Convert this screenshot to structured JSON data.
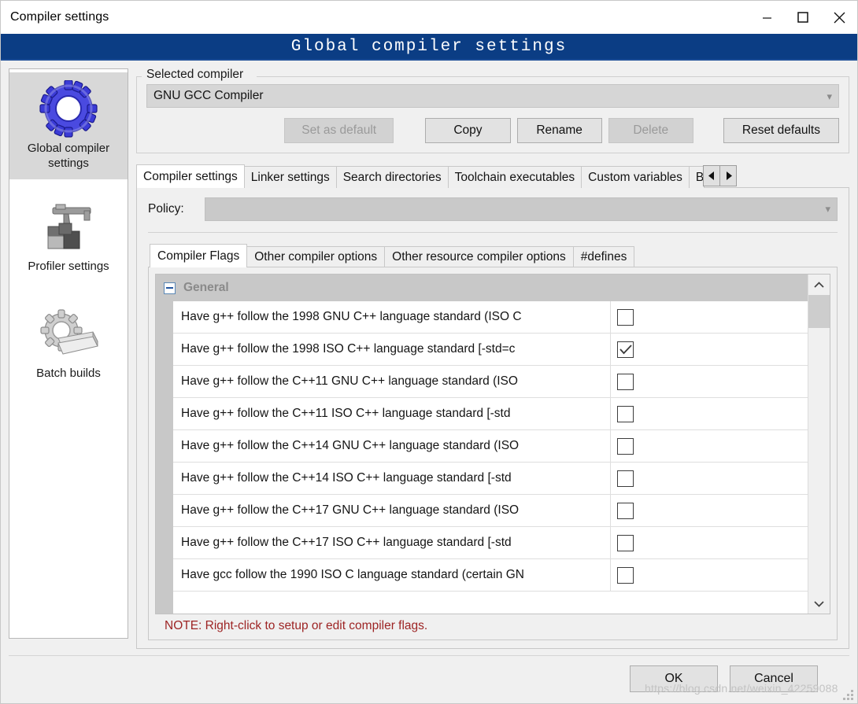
{
  "window": {
    "title": "Compiler settings",
    "minimize_icon": "minimize-icon",
    "maximize_icon": "maximize-icon",
    "close_icon": "close-icon",
    "banner_title": "Global compiler settings",
    "banner_color": "#0b3d84"
  },
  "sidebar": {
    "items": [
      {
        "label": "Global compiler settings",
        "icon": "blue-gear-icon",
        "selected": true
      },
      {
        "label": "Profiler settings",
        "icon": "caliper-icon",
        "selected": false
      },
      {
        "label": "Batch builds",
        "icon": "gear-stack-icon",
        "selected": false
      }
    ]
  },
  "selected_compiler": {
    "legend": "Selected compiler",
    "value": "GNU GCC Compiler",
    "caret_icon": "chevron-down-icon",
    "buttons": [
      {
        "label": "Set as default",
        "disabled": true
      },
      {
        "label": "Copy",
        "disabled": false
      },
      {
        "label": "Rename",
        "disabled": false
      },
      {
        "label": "Delete",
        "disabled": true
      },
      {
        "label": "Reset defaults",
        "disabled": false
      }
    ]
  },
  "outer_tabs": {
    "items": [
      {
        "label": "Compiler settings",
        "active": true
      },
      {
        "label": "Linker settings",
        "active": false
      },
      {
        "label": "Search directories",
        "active": false
      },
      {
        "label": "Toolchain executables",
        "active": false
      },
      {
        "label": "Custom variables",
        "active": false
      },
      {
        "label": "B",
        "active": false,
        "clipped": true
      }
    ],
    "scroll_left_icon": "triangle-left-icon",
    "scroll_right_icon": "triangle-right-icon"
  },
  "policy": {
    "label": "Policy:",
    "value": "",
    "caret_icon": "chevron-down-icon"
  },
  "inner_tabs": {
    "items": [
      {
        "label": "Compiler Flags",
        "active": true
      },
      {
        "label": "Other compiler options",
        "active": false
      },
      {
        "label": "Other resource compiler options",
        "active": false
      },
      {
        "label": "#defines",
        "active": false
      }
    ]
  },
  "flags_list": {
    "group_title": "General",
    "expander_icon": "minus-box-icon",
    "rows": [
      {
        "label": "Have g++ follow the 1998 GNU C++ language standard (ISO C",
        "checked": false
      },
      {
        "label": "Have g++ follow the 1998 ISO C++ language standard  [-std=c",
        "checked": true
      },
      {
        "label": "Have g++ follow the C++11 GNU C++ language standard (ISO",
        "checked": false
      },
      {
        "label": "Have g++ follow the C++11 ISO C++ language standard  [-std",
        "checked": false
      },
      {
        "label": "Have g++ follow the C++14 GNU C++ language standard (ISO",
        "checked": false
      },
      {
        "label": "Have g++ follow the C++14 ISO C++ language standard  [-std",
        "checked": false
      },
      {
        "label": "Have g++ follow the C++17 GNU C++ language standard (ISO",
        "checked": false
      },
      {
        "label": "Have g++ follow the C++17 ISO C++ language standard  [-std",
        "checked": false
      },
      {
        "label": "Have gcc follow the 1990 ISO C language standard  (certain GN",
        "checked": false
      }
    ],
    "scroll_up_icon": "chevron-up-icon",
    "scroll_down_icon": "chevron-down-icon"
  },
  "note": {
    "text": "NOTE: Right-click to setup or edit compiler flags.",
    "color": "#9d2424"
  },
  "footer": {
    "ok_label": "OK",
    "cancel_label": "Cancel"
  },
  "watermark": {
    "text": "https://blog.csdn.net/weixin_42259088"
  }
}
